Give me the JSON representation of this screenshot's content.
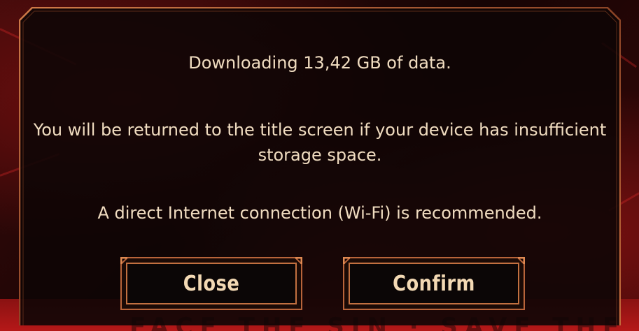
{
  "dialog": {
    "message_download": "Downloading 13,42 GB of data.",
    "message_storage": "You will be returned to the title screen if your device has insufficient storage space.",
    "message_connection": "A direct Internet connection (Wi-Fi) is recommended."
  },
  "buttons": {
    "close_label": "Close",
    "confirm_label": "Confirm"
  },
  "colors": {
    "text": "#f0dcc0",
    "button_text": "#f3d9b4",
    "frame_copper": "#b8643a",
    "button_fill": "#0b0606",
    "accent_red": "#b51818"
  }
}
